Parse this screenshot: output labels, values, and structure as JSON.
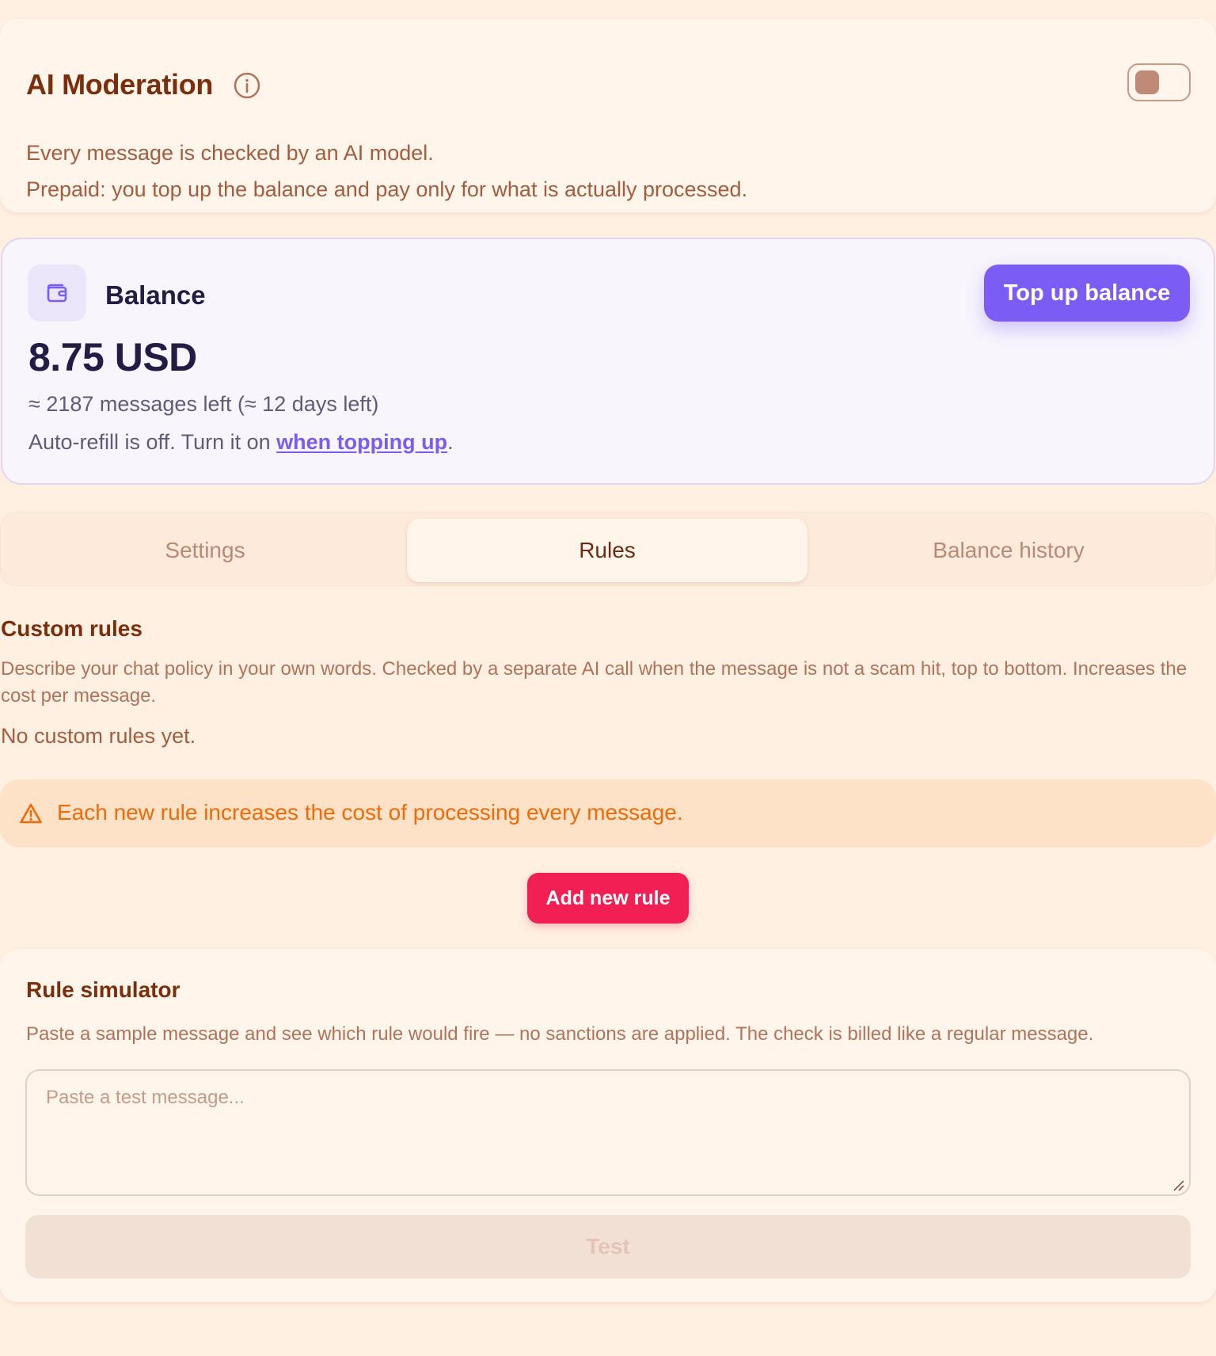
{
  "header": {
    "title": "AI Moderation",
    "description_line1": "Every message is checked by an AI model.",
    "description_line2": "Prepaid: you top up the balance and pay only for what is actually processed.",
    "toggle_on": false
  },
  "balance": {
    "label": "Balance",
    "amount": "8.75 USD",
    "estimate": "≈ 2187 messages left (≈ 12 days left)",
    "autorefill_prefix": "Auto-refill is off. Turn it on ",
    "autorefill_link": "when topping up",
    "autorefill_suffix": ".",
    "topup_label": "Top up balance"
  },
  "tabs": [
    {
      "label": "Settings",
      "active": false
    },
    {
      "label": "Rules",
      "active": true
    },
    {
      "label": "Balance history",
      "active": false
    }
  ],
  "custom_rules": {
    "title": "Custom rules",
    "description": "Describe your chat policy in your own words. Checked by a separate AI call when the message is not a scam hit, top to bottom. Increases the cost per message.",
    "empty_text": "No custom rules yet.",
    "warning": "Each new rule increases the cost of processing every message.",
    "add_button": "Add new rule"
  },
  "simulator": {
    "title": "Rule simulator",
    "description": "Paste a sample message and see which rule would fire — no sanctions are applied. The check is billed like a regular message.",
    "placeholder": "Paste a test message...",
    "value": "",
    "test_button": "Test"
  },
  "icons": {
    "info": "info-circle-icon",
    "wallet": "wallet-icon",
    "warning": "warning-triangle-icon"
  },
  "colors": {
    "accent_purple": "#7b5cf5",
    "danger_pink": "#f21f55",
    "warning_orange": "#f06a08",
    "title_brown": "#7a2e0c"
  }
}
